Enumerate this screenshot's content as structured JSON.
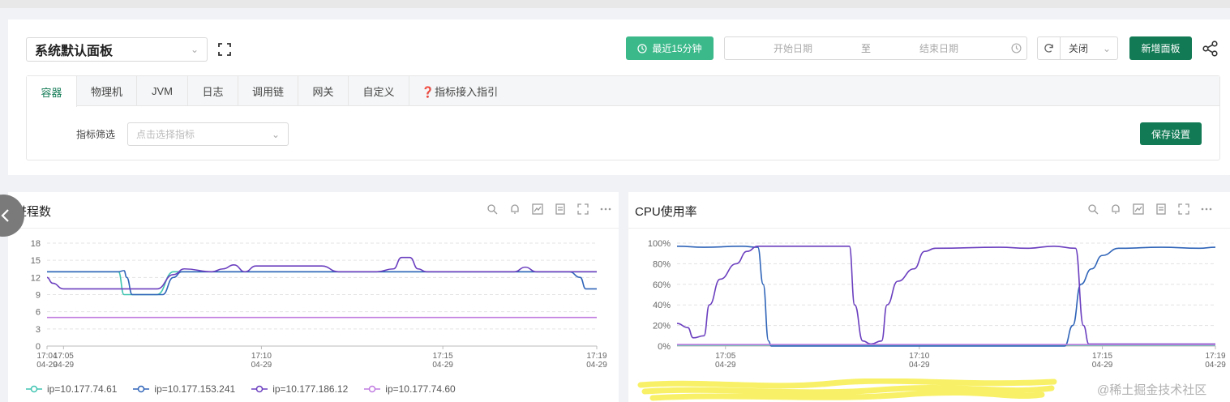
{
  "toolbar": {
    "panel_select": "系统默认面板",
    "recent_btn": "最近15分钟",
    "date_start": "开始日期",
    "date_sep": "至",
    "date_end": "结束日期",
    "refresh_label": "关闭",
    "add_panel_btn": "新增面板"
  },
  "tabs": [
    {
      "label": "容器",
      "active": true
    },
    {
      "label": "物理机"
    },
    {
      "label": "JVM"
    },
    {
      "label": "日志"
    },
    {
      "label": "调用链"
    },
    {
      "label": "网关"
    },
    {
      "label": "自定义"
    },
    {
      "label": "❓指标接入指引"
    }
  ],
  "filter": {
    "label": "指标筛选",
    "placeholder": "点击选择指标",
    "save_btn": "保存设置"
  },
  "colors": {
    "accent": "#127a55",
    "recent": "#3cb98b",
    "s_teal": "#3ec4b0",
    "s_blue": "#2f64b8",
    "s_purple": "#6b3fbf",
    "s_violet": "#c07be0"
  },
  "charts": [
    {
      "title": "进程数",
      "chart_data": {
        "type": "line",
        "y_ticks": [
          "18",
          "15",
          "12",
          "9",
          "6",
          "3",
          "0"
        ],
        "ylim": [
          0,
          18
        ],
        "x_ticks": [
          {
            "t": "17:04",
            "d": "04-29"
          },
          {
            "t": "17:05",
            "d": "04-29"
          },
          {
            "t": "17:10",
            "d": "04-29"
          },
          {
            "t": "17:15",
            "d": "04-29"
          },
          {
            "t": "17:19",
            "d": "04-29"
          }
        ],
        "series": [
          {
            "name": "ip=10.177.74.61",
            "color": "s_teal",
            "points": [
              [
                0,
                13
              ],
              [
                0.13,
                13
              ],
              [
                0.14,
                9
              ],
              [
                0.2,
                9
              ],
              [
                0.23,
                13
              ],
              [
                0.37,
                13
              ],
              [
                0.5,
                13
              ],
              [
                0.7,
                13
              ],
              [
                0.97,
                13
              ],
              [
                1,
                13
              ]
            ]
          },
          {
            "name": "ip=10.177.153.241",
            "color": "s_blue",
            "points": [
              [
                0,
                13
              ],
              [
                0.13,
                13
              ],
              [
                0.14,
                13.2
              ],
              [
                0.145,
                12
              ],
              [
                0.155,
                9
              ],
              [
                0.21,
                9
              ],
              [
                0.23,
                12
              ],
              [
                0.245,
                13
              ],
              [
                0.3,
                13
              ],
              [
                0.55,
                13
              ],
              [
                0.7,
                13
              ],
              [
                0.95,
                13
              ],
              [
                0.97,
                12
              ],
              [
                0.98,
                10
              ],
              [
                1,
                10
              ]
            ]
          },
          {
            "name": "ip=10.177.186.12",
            "color": "s_purple",
            "points": [
              [
                0,
                12
              ],
              [
                0.01,
                11
              ],
              [
                0.03,
                10
              ],
              [
                0.2,
                10
              ],
              [
                0.23,
                12.5
              ],
              [
                0.25,
                13.5
              ],
              [
                0.3,
                13
              ],
              [
                0.32,
                13.5
              ],
              [
                0.34,
                14.2
              ],
              [
                0.36,
                13
              ],
              [
                0.38,
                14
              ],
              [
                0.5,
                14
              ],
              [
                0.53,
                13
              ],
              [
                0.57,
                13
              ],
              [
                0.6,
                13
              ],
              [
                0.63,
                13.5
              ],
              [
                0.645,
                15.5
              ],
              [
                0.66,
                15.5
              ],
              [
                0.675,
                13.5
              ],
              [
                0.69,
                13
              ],
              [
                0.85,
                13
              ],
              [
                0.87,
                13.8
              ],
              [
                0.89,
                13
              ],
              [
                1,
                13
              ]
            ]
          },
          {
            "name": "ip=10.177.74.60",
            "color": "s_violet",
            "points": [
              [
                0,
                5
              ],
              [
                1,
                5
              ]
            ]
          }
        ]
      }
    },
    {
      "title": "CPU使用率",
      "chart_data": {
        "type": "line",
        "y_ticks": [
          "100%",
          "80%",
          "60%",
          "40%",
          "20%",
          "0%"
        ],
        "ylim": [
          0,
          100
        ],
        "x_ticks": [
          {
            "t": "17:05",
            "d": "04-29"
          },
          {
            "t": "17:10",
            "d": "04-29"
          },
          {
            "t": "17:15",
            "d": "04-29"
          },
          {
            "t": "17:19",
            "d": "04-29"
          }
        ],
        "series": [
          {
            "name": "",
            "color": "s_teal",
            "points": [
              [
                0,
                1
              ],
              [
                1,
                1
              ]
            ]
          },
          {
            "name": "",
            "color": "s_blue",
            "points": [
              [
                0,
                97
              ],
              [
                0.05,
                96
              ],
              [
                0.12,
                97
              ],
              [
                0.15,
                96
              ],
              [
                0.16,
                60
              ],
              [
                0.17,
                5
              ],
              [
                0.175,
                0
              ],
              [
                0.5,
                0
              ],
              [
                0.72,
                0
              ],
              [
                0.735,
                20
              ],
              [
                0.75,
                60
              ],
              [
                0.77,
                75
              ],
              [
                0.79,
                88
              ],
              [
                0.82,
                95
              ],
              [
                0.9,
                96
              ],
              [
                0.97,
                95
              ],
              [
                1,
                96
              ]
            ]
          },
          {
            "name": "",
            "color": "s_purple",
            "points": [
              [
                0,
                22
              ],
              [
                0.02,
                18
              ],
              [
                0.03,
                8
              ],
              [
                0.05,
                10
              ],
              [
                0.06,
                40
              ],
              [
                0.08,
                65
              ],
              [
                0.11,
                80
              ],
              [
                0.13,
                92
              ],
              [
                0.15,
                97
              ],
              [
                0.3,
                97
              ],
              [
                0.32,
                97
              ],
              [
                0.33,
                40
              ],
              [
                0.345,
                5
              ],
              [
                0.36,
                2
              ],
              [
                0.38,
                5
              ],
              [
                0.39,
                40
              ],
              [
                0.41,
                63
              ],
              [
                0.44,
                75
              ],
              [
                0.46,
                92
              ],
              [
                0.48,
                95
              ],
              [
                0.6,
                96
              ],
              [
                0.65,
                95
              ],
              [
                0.7,
                97
              ],
              [
                0.74,
                95
              ],
              [
                0.755,
                20
              ],
              [
                0.765,
                2
              ],
              [
                1,
                2
              ]
            ]
          },
          {
            "name": "",
            "color": "s_violet",
            "points": [
              [
                0,
                1.5
              ],
              [
                1,
                1.5
              ]
            ]
          }
        ]
      }
    }
  ],
  "watermark": "@稀土掘金技术社区"
}
